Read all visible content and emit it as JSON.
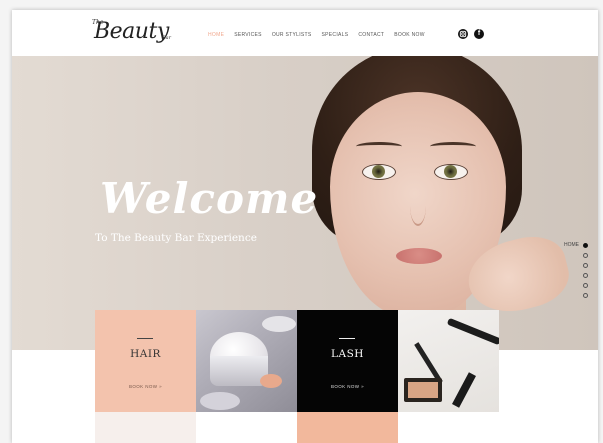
{
  "header": {
    "logo_prefix": "The",
    "logo_text": "Beauty",
    "logo_suffix": "Bar",
    "nav": [
      "HOME",
      "SERVICES",
      "OUR STYLISTS",
      "SPECIALS",
      "CONTACT",
      "BOOK NOW"
    ],
    "active_nav": "HOME",
    "social": [
      "instagram-icon",
      "facebook-icon"
    ],
    "facebook_glyph": "f"
  },
  "hero": {
    "title": "Welcome",
    "subtitle": "To The Beauty Bar Experience"
  },
  "side_nav": {
    "label": "HOME",
    "dots": 6,
    "active_index": 0
  },
  "tiles": [
    {
      "title": "HAIR",
      "book": "BOOK NOW »"
    },
    {
      "title": "LASH",
      "book": "BOOK NOW »"
    }
  ],
  "colors": {
    "accent": "#f1a78d",
    "hair_tile": "#f3c3ad",
    "lash_tile": "#050505"
  }
}
